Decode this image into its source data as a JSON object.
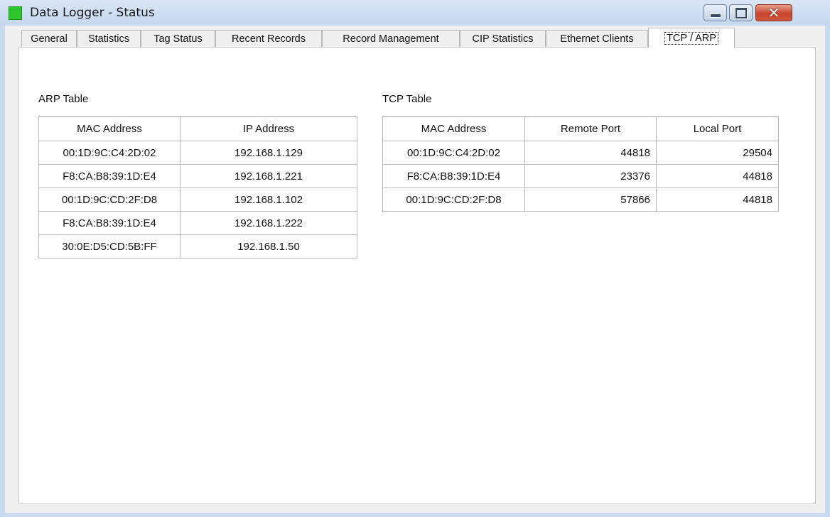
{
  "window": {
    "title": "Data Logger - Status",
    "icon": "status-green-square-icon",
    "controls": {
      "minimize": "minimize-icon",
      "maximize": "maximize-icon",
      "close_label": "✕"
    }
  },
  "tabs": [
    {
      "label": "General"
    },
    {
      "label": "Statistics"
    },
    {
      "label": "Tag Status"
    },
    {
      "label": "Recent Records"
    },
    {
      "label": "Record Management"
    },
    {
      "label": "CIP Statistics"
    },
    {
      "label": "Ethernet Clients"
    },
    {
      "label": "TCP / ARP",
      "active": true
    }
  ],
  "arp_table": {
    "title": "ARP Table",
    "columns": [
      "MAC Address",
      "IP Address"
    ],
    "rows": [
      [
        "00:1D:9C:C4:2D:02",
        "192.168.1.129"
      ],
      [
        "F8:CA:B8:39:1D:E4",
        "192.168.1.221"
      ],
      [
        "00:1D:9C:CD:2F:D8",
        "192.168.1.102"
      ],
      [
        "F8:CA:B8:39:1D:E4",
        "192.168.1.222"
      ],
      [
        "30:0E:D5:CD:5B:FF",
        "192.168.1.50"
      ]
    ]
  },
  "tcp_table": {
    "title": "TCP Table",
    "columns": [
      "MAC Address",
      "Remote Port",
      "Local Port"
    ],
    "rows": [
      [
        "00:1D:9C:C4:2D:02",
        "44818",
        "29504"
      ],
      [
        "F8:CA:B8:39:1D:E4",
        "23376",
        "44818"
      ],
      [
        "00:1D:9C:CD:2F:D8",
        "57866",
        "44818"
      ]
    ]
  },
  "colors": {
    "titlebar": "#c7daf0",
    "status_icon": "#2ec42e",
    "close_button": "#c8432b"
  }
}
